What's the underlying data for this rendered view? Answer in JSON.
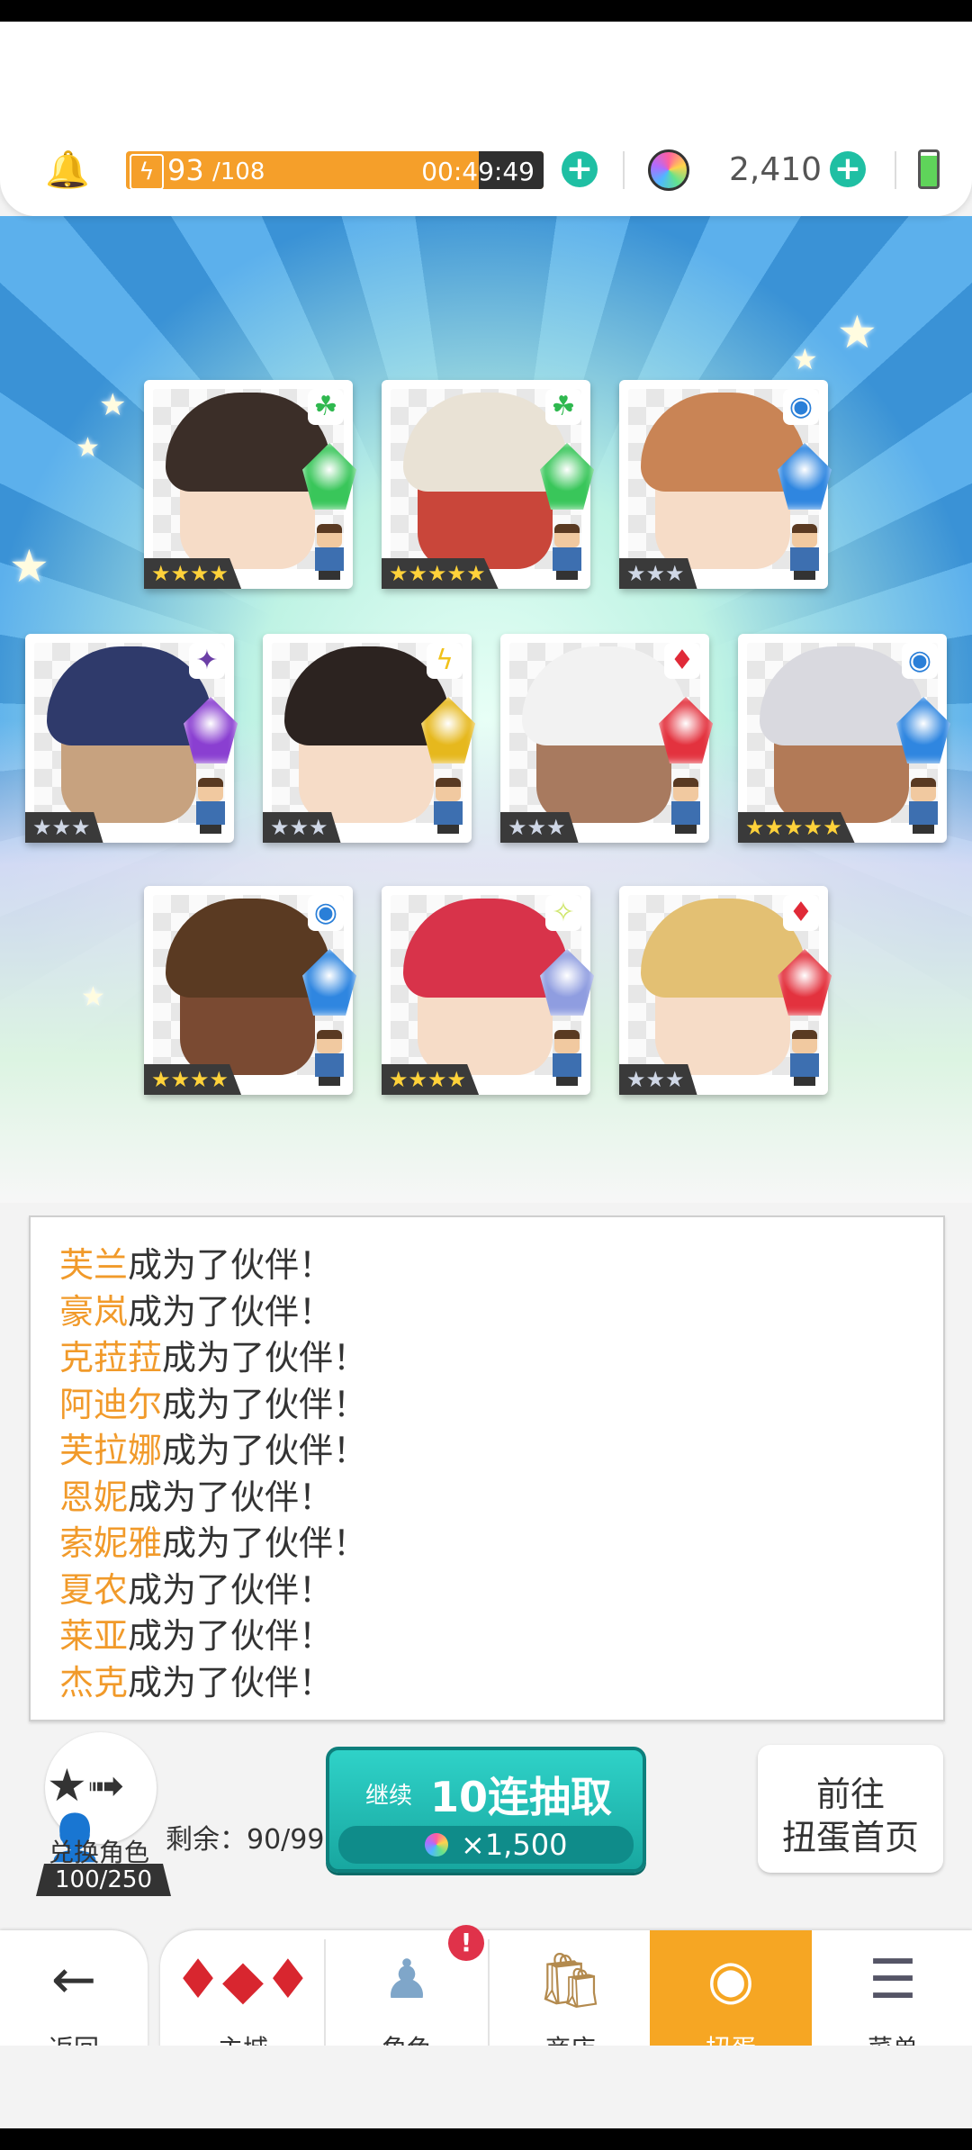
{
  "status": {
    "stamina_current": "93",
    "stamina_max": "/108",
    "stamina_timer": "00:49:49",
    "gems": "2,410",
    "stamina_fraction": 0.86
  },
  "cards": [
    {
      "id": "c1",
      "element": "wind",
      "element_color": "#2fb84f",
      "rarity": 4,
      "stars": "★★★★",
      "crystal_color": "#39c65a"
    },
    {
      "id": "c2",
      "element": "wind",
      "element_color": "#2fb84f",
      "rarity": 5,
      "stars": "★★★★★",
      "crystal_color": "#39c65a"
    },
    {
      "id": "c3",
      "element": "water",
      "element_color": "#2a7fd8",
      "rarity": 3,
      "stars": "★★★",
      "crystal_color": "#2f86e0"
    },
    {
      "id": "c4",
      "element": "dark",
      "element_color": "#6b3fa6",
      "rarity": 3,
      "stars": "★★★",
      "crystal_color": "#8a3fd1"
    },
    {
      "id": "c5",
      "element": "thunder",
      "element_color": "#f1c21a",
      "rarity": 3,
      "stars": "★★★",
      "crystal_color": "#e6b81d"
    },
    {
      "id": "c6",
      "element": "fire",
      "element_color": "#e02a38",
      "rarity": 3,
      "stars": "★★★",
      "crystal_color": "#e3323e"
    },
    {
      "id": "c7",
      "element": "water",
      "element_color": "#2a7fd8",
      "rarity": 5,
      "stars": "★★★★★",
      "crystal_color": "#2f86e0"
    },
    {
      "id": "c8",
      "element": "water",
      "element_color": "#2a7fd8",
      "rarity": 4,
      "stars": "★★★★",
      "crystal_color": "#2f86e0"
    },
    {
      "id": "c9",
      "element": "light",
      "element_color": "#cfe66a",
      "rarity": 4,
      "stars": "★★★★",
      "crystal_color": "#8f9de0"
    },
    {
      "id": "c10",
      "element": "fire",
      "element_color": "#e02a38",
      "rarity": 3,
      "stars": "★★★",
      "crystal_color": "#e3323e"
    }
  ],
  "log": {
    "suffix": "成为了伙伴！",
    "names": [
      "芙兰",
      "豪岚",
      "克菈菈",
      "阿迪尔",
      "芙拉娜",
      "恩妮",
      "索妮雅",
      "夏农",
      "莱亚",
      "杰克"
    ]
  },
  "actions": {
    "exchange_label": "兑换角色",
    "exchange_count": "100/250",
    "remaining": "剩余：90/99",
    "gacha_continue": "继续",
    "gacha_label": "10连抽取",
    "gacha_cost": "×1,500",
    "goto_line1": "前往",
    "goto_line2": "扭蛋首页"
  },
  "nav": {
    "back": "返回",
    "items": [
      "主城",
      "角色",
      "商店",
      "扭蛋",
      "菜单"
    ],
    "active": "扭蛋",
    "badge": "!"
  }
}
